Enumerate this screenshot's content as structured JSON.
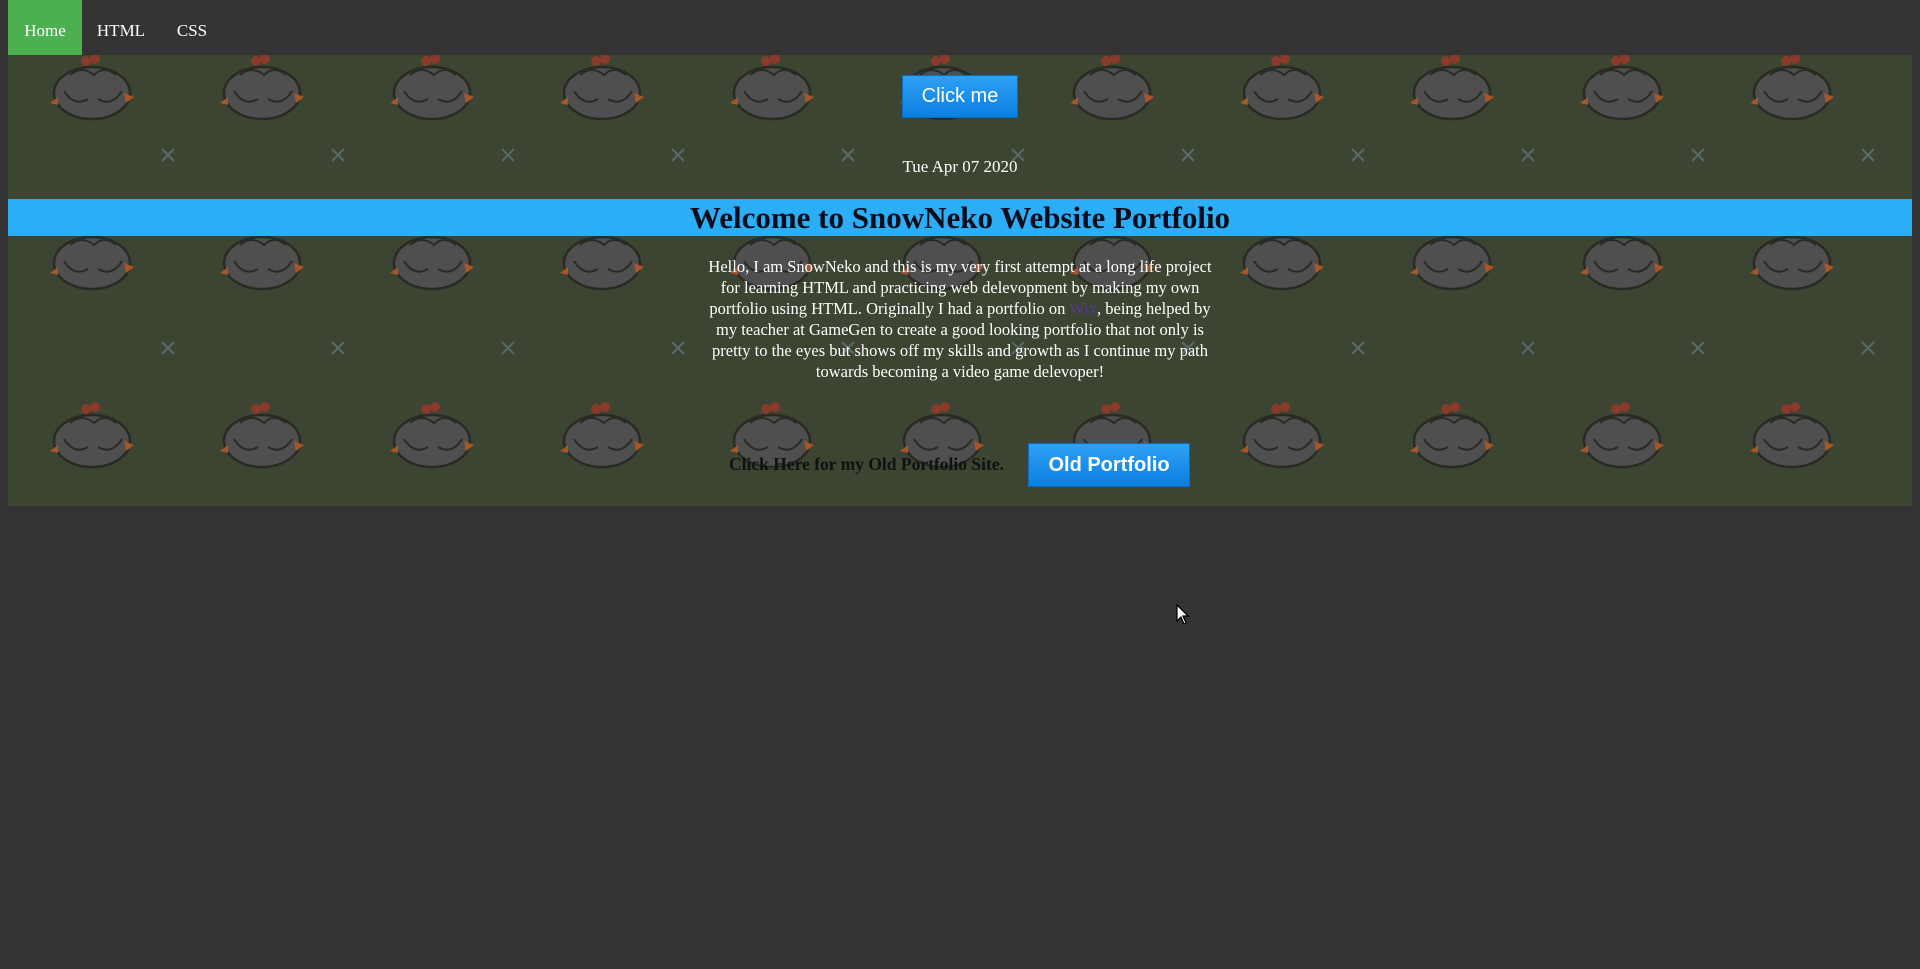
{
  "nav": {
    "items": [
      {
        "label": "Home",
        "active": true
      },
      {
        "label": "HTML",
        "active": false
      },
      {
        "label": "CSS",
        "active": false
      }
    ],
    "active_color": "#4caf50"
  },
  "main": {
    "click_button": "Click me",
    "date": "Tue Apr 07 2020",
    "title": "Welcome to SnowNeko Website Portfolio",
    "intro": {
      "before_link": "Hello, I am SnowNeko and this is my very first attempt at a long life project for learning HTML and practicing web delevopment by making my own portfolio using HTML. Originally I had a portfolio on ",
      "link_text": "Wix",
      "after_link": ", being helped by my teacher at GameGen to create a good looking portfolio that not only is pretty to the eyes but shows off my skills and growth as I continue my path towards becoming a video game delevoper!"
    },
    "old_portfolio_label": "Click Here for my Old Portfolio Site.",
    "old_portfolio_button": "Old Portfolio"
  },
  "colors": {
    "page_background": "#333333",
    "content_background": "#3c4432",
    "banner": "#2baef6",
    "button": "#1a8cf0"
  },
  "icons": [
    "chicken-icon",
    "cross-icon",
    "mouse-cursor-icon"
  ]
}
